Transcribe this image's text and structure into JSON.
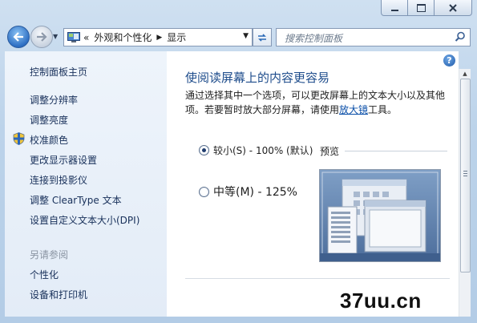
{
  "nav": {
    "breadcrumb_prefix": "«",
    "breadcrumb_1": "外观和个性化",
    "breadcrumb_2": "显示",
    "search_placeholder": "搜索控制面板"
  },
  "sidebar": {
    "home": "控制面板主页",
    "items": [
      {
        "label": "调整分辨率"
      },
      {
        "label": "调整亮度"
      },
      {
        "label": "校准颜色"
      },
      {
        "label": "更改显示器设置"
      },
      {
        "label": "连接到投影仪"
      },
      {
        "label": "调整 ClearType 文本"
      },
      {
        "label": "设置自定义文本大小(DPI)"
      }
    ],
    "see_also_header": "另请参阅",
    "see_also": [
      {
        "label": "个性化"
      },
      {
        "label": "设备和打印机"
      }
    ]
  },
  "main": {
    "title": "使阅读屏幕上的内容更容易",
    "desc_before": "通过选择其中一个选项，可以更改屏幕上的文本大小以及其他项。若要暂时放大部分屏幕，请使用",
    "desc_link": "放大镜",
    "desc_after": "工具。",
    "options": [
      {
        "label": "较小(S) - 100% (默认)",
        "selected": true
      },
      {
        "label": "中等(M) - 125%",
        "selected": false
      }
    ],
    "preview_label": "预览"
  },
  "help_glyph": "?",
  "watermark": "37uu.cn",
  "colors": {
    "title_blue": "#1f4d8c",
    "link_blue": "#0b4fa8",
    "sidebar_bg": "#e7eff8",
    "frame": "#bcd3ea"
  }
}
